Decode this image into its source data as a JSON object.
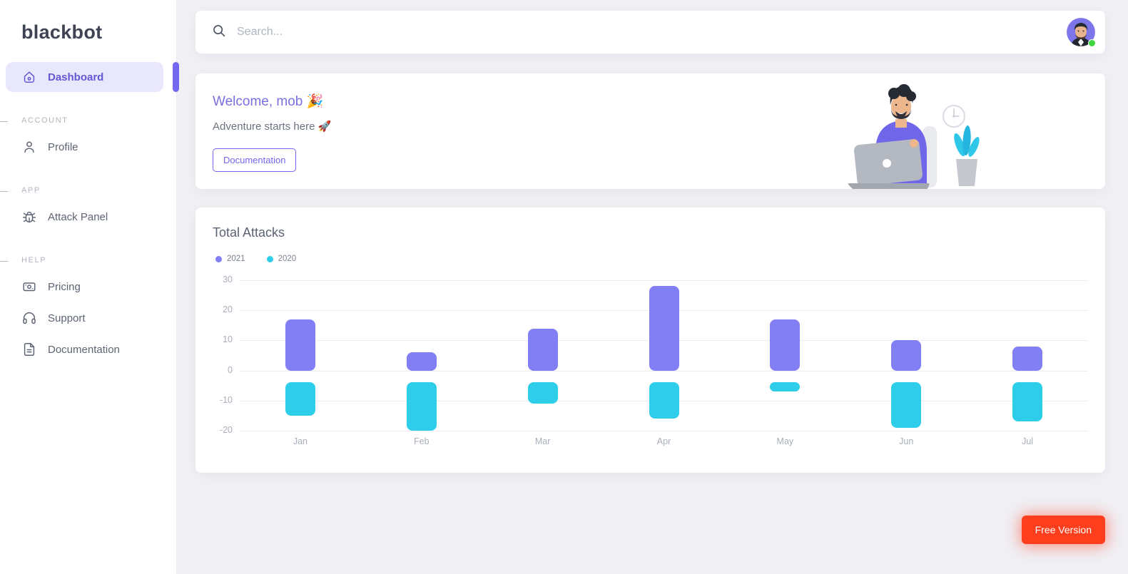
{
  "sidebar": {
    "logo_text": "blackbot",
    "nav": [
      {
        "type": "item",
        "label": "Dashboard",
        "icon": "home-icon",
        "active": true
      },
      {
        "type": "section",
        "label": "ACCOUNT"
      },
      {
        "type": "item",
        "label": "Profile",
        "icon": "user-icon",
        "active": false
      },
      {
        "type": "section",
        "label": "APP"
      },
      {
        "type": "item",
        "label": "Attack Panel",
        "icon": "bug-icon",
        "active": false
      },
      {
        "type": "section",
        "label": "HELP"
      },
      {
        "type": "item",
        "label": "Pricing",
        "icon": "cash-icon",
        "active": false
      },
      {
        "type": "item",
        "label": "Support",
        "icon": "headset-icon",
        "active": false
      },
      {
        "type": "item",
        "label": "Documentation",
        "icon": "file-text-icon",
        "active": false
      }
    ]
  },
  "topbar": {
    "search_placeholder": "Search...",
    "search_icon": "search-icon",
    "avatar_status": "online"
  },
  "welcome_card": {
    "title": "Welcome, mob 🎉",
    "subtitle": "Adventure starts here 🚀",
    "button_label": "Documentation"
  },
  "chart_card": {
    "title": "Total Attacks"
  },
  "chart_data": {
    "type": "bar",
    "title": "Total Attacks",
    "categories": [
      "Jan",
      "Feb",
      "Mar",
      "Apr",
      "May",
      "Jun",
      "Jul"
    ],
    "series": [
      {
        "name": "2021",
        "color": "#827ff5",
        "values": [
          [
            0,
            17
          ],
          [
            0,
            6
          ],
          [
            0,
            14
          ],
          [
            0,
            28
          ],
          [
            0,
            17
          ],
          [
            0,
            10
          ],
          [
            0,
            8
          ]
        ]
      },
      {
        "name": "2020",
        "color": "#2ecde9",
        "values": [
          [
            -4,
            -15
          ],
          [
            -4,
            -20
          ],
          [
            -4,
            -11
          ],
          [
            -4,
            -16
          ],
          [
            -4,
            -7
          ],
          [
            -4,
            -19
          ],
          [
            -4,
            -17
          ]
        ]
      }
    ],
    "y_ticks": [
      30,
      20,
      10,
      0,
      -10,
      -20
    ],
    "ylim": [
      -20,
      30
    ],
    "grid": "horizontal",
    "legend_position": "top-left"
  },
  "floating_button": {
    "label": "Free Version"
  },
  "colors": {
    "primary": "#7367f0",
    "active_bg": "#e9e7fc",
    "series_2021": "#827ff5",
    "series_2020": "#2ecde9",
    "free_button": "#ff3e1d",
    "status_online": "#3ed53e"
  }
}
